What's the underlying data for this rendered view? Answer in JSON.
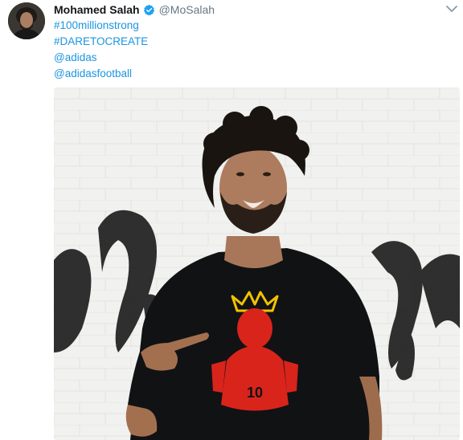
{
  "tweet": {
    "author_name": "Mohamed Salah",
    "author_handle": "@MoSalah",
    "lines": [
      "#100millionstrong",
      "#DARETOCREATE",
      "@adidas",
      "@adidasfootball"
    ]
  },
  "shirt": {
    "number": "10"
  },
  "colors": {
    "link": "#1b95e0",
    "verified": "#1da1f2",
    "handle": "#657786",
    "shirt_print": "#d9241b",
    "crown": "#f2c200"
  },
  "icons": {
    "verified": "verified-badge-icon",
    "menu": "chevron-down-icon"
  }
}
